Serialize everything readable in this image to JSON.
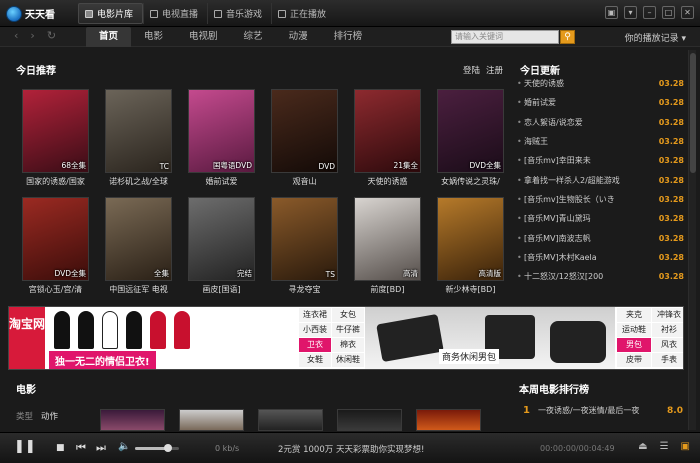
{
  "app": {
    "name": "天天看"
  },
  "toptabs": [
    {
      "label": "电影片库",
      "active": true
    },
    {
      "label": "电视直播"
    },
    {
      "label": "音乐游戏"
    },
    {
      "label": "正在播放"
    }
  ],
  "nav": {
    "tabs": [
      "首页",
      "电影",
      "电视剧",
      "综艺",
      "动漫",
      "排行榜"
    ],
    "search_placeholder": "请输入关键词",
    "history_label": "你的播放记录 ▾"
  },
  "today": {
    "title": "今日推荐",
    "login": "登陆",
    "register": "注册",
    "row1": [
      {
        "caption": "国家的诱惑/国家",
        "badge": "68全集",
        "colors": [
          "#b2223a",
          "#3a0d16"
        ]
      },
      {
        "caption": "诺杉矶之战/全球",
        "badge": "TC",
        "colors": [
          "#6b6459",
          "#2a241d"
        ]
      },
      {
        "caption": "婚前试爱",
        "badge": "国粤语DVD",
        "colors": [
          "#c44a8e",
          "#5a1a40"
        ]
      },
      {
        "caption": "观音山",
        "badge": "DVD",
        "colors": [
          "#4a2a1c",
          "#130a07"
        ]
      },
      {
        "caption": "天使的诱惑",
        "badge": "21集全",
        "colors": [
          "#8d2a2f",
          "#2d0a0c"
        ]
      },
      {
        "caption": "女娲传说之灵珠/",
        "badge": "DVD全集",
        "colors": [
          "#4b1f3f",
          "#1a0c18"
        ]
      }
    ],
    "row2": [
      {
        "caption": "宫锁心玉/宫/清",
        "badge": "DVD全集",
        "colors": [
          "#9b2a22",
          "#3b0d0a"
        ]
      },
      {
        "caption": "中国远征军 电视",
        "badge": "全集",
        "colors": [
          "#7a6a55",
          "#2a2016"
        ]
      },
      {
        "caption": "画皮[国语]",
        "badge": "完结",
        "colors": [
          "#6d6d6d",
          "#222"
        ]
      },
      {
        "caption": "寻龙夺宝",
        "badge": "TS",
        "colors": [
          "#8a5a2a",
          "#2a1a0c"
        ]
      },
      {
        "caption": "前度[BD]",
        "badge": "高清",
        "colors": [
          "#d8d4d0",
          "#554e4a"
        ]
      },
      {
        "caption": "新少林寺[BD]",
        "badge": "高清版",
        "colors": [
          "#b67a2a",
          "#3a220a"
        ]
      }
    ]
  },
  "updates": {
    "title": "今日更新",
    "items": [
      {
        "title": "天使的诱惑",
        "date": "03.28"
      },
      {
        "title": "婚前试爱",
        "date": "03.28"
      },
      {
        "title": "恋人絮语/说恋爱",
        "date": "03.28"
      },
      {
        "title": "海贼王",
        "date": "03.28"
      },
      {
        "title": "[音乐mv]幸田来未",
        "date": "03.28"
      },
      {
        "title": "拿着找一样杀人2/超能游戏",
        "date": "03.28"
      },
      {
        "title": "[音乐mv]生物股长（いき",
        "date": "03.28"
      },
      {
        "title": "[音乐MV]青山黛玛",
        "date": "03.28"
      },
      {
        "title": "[音乐MV]南波志帆",
        "date": "03.28"
      },
      {
        "title": "[音乐MV]木村Kaela",
        "date": "03.28"
      },
      {
        "title": "十二怒汉/12怒汉[200",
        "date": "03.28"
      }
    ]
  },
  "ad": {
    "logo": "淘宝网",
    "slogan": "独一无二的情侣卫衣!",
    "bag_text": "商务休闲男包",
    "cats_left": [
      "连衣裙",
      "女包",
      "小西装",
      "牛仔裤",
      "卫衣",
      "棉衣",
      "女鞋",
      "休闲鞋"
    ],
    "cats_right": [
      "夹克",
      "冲锋衣",
      "运动鞋",
      "衬衫",
      "男包",
      "风衣",
      "皮带",
      "手表"
    ]
  },
  "movies": {
    "title": "电影",
    "filters": [
      "类型",
      "动作"
    ]
  },
  "ranking": {
    "title": "本周电影排行榜",
    "items": [
      {
        "rank": "1",
        "name": "一夜诱惑/一夜迷情/最后一夜",
        "score": "8.0"
      }
    ]
  },
  "player": {
    "speed": "0 kb/s",
    "marquee": "2元赏 1000万 天天彩票助你实现梦想!",
    "time": "00:00:00/00:04:49"
  }
}
